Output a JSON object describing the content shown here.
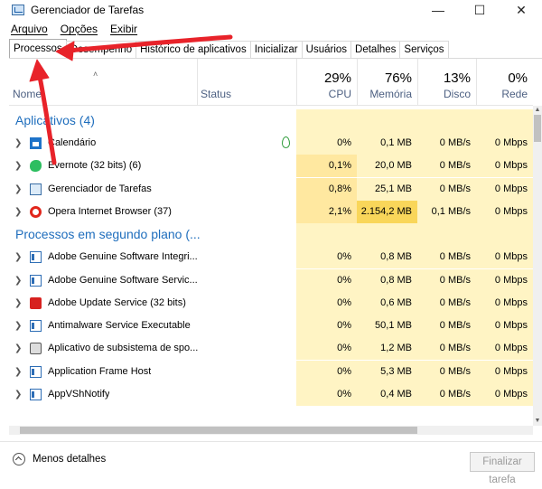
{
  "window": {
    "title": "Gerenciador de Tarefas",
    "controls": [
      "—",
      "☐",
      "✕"
    ]
  },
  "menu": [
    "Arquivo",
    "Opções",
    "Exibir"
  ],
  "tabs": [
    "Processos",
    "Desempenho",
    "Histórico de aplicativos",
    "Inicializar",
    "Usuários",
    "Detalhes",
    "Serviços"
  ],
  "active_tab": "Processos",
  "columns": {
    "name": "Nome",
    "status": "Status",
    "cpu": {
      "pct": "29%",
      "label": "CPU"
    },
    "memory": {
      "pct": "76%",
      "label": "Memória"
    },
    "disk": {
      "pct": "13%",
      "label": "Disco"
    },
    "network": {
      "pct": "0%",
      "label": "Rede"
    }
  },
  "groups": {
    "apps": "Aplicativos (4)",
    "background": "Processos em segundo plano (..."
  },
  "apps": [
    {
      "name": "Calendário",
      "icon": "calendar-icon",
      "status_icon": "leaf-icon",
      "cpu": "0%",
      "memory": "0,1 MB",
      "disk": "0 MB/s",
      "network": "0 Mbps"
    },
    {
      "name": "Evernote (32 bits) (6)",
      "icon": "evernote-icon",
      "cpu": "0,1%",
      "memory": "20,0 MB",
      "disk": "0 MB/s",
      "network": "0 Mbps"
    },
    {
      "name": "Gerenciador de Tarefas",
      "icon": "taskmanager-icon",
      "cpu": "0,8%",
      "memory": "25,1 MB",
      "disk": "0 MB/s",
      "network": "0 Mbps"
    },
    {
      "name": "Opera Internet Browser (37)",
      "icon": "opera-icon",
      "cpu": "2,1%",
      "memory": "2.154,2 MB",
      "disk": "0,1 MB/s",
      "network": "0 Mbps"
    }
  ],
  "background": [
    {
      "name": "Adobe Genuine Software Integri...",
      "icon": "service-icon",
      "cpu": "0%",
      "memory": "0,8 MB",
      "disk": "0 MB/s",
      "network": "0 Mbps"
    },
    {
      "name": "Adobe Genuine Software Servic...",
      "icon": "service-icon",
      "cpu": "0%",
      "memory": "0,8 MB",
      "disk": "0 MB/s",
      "network": "0 Mbps"
    },
    {
      "name": "Adobe Update Service (32 bits)",
      "icon": "adobe-icon",
      "cpu": "0%",
      "memory": "0,6 MB",
      "disk": "0 MB/s",
      "network": "0 Mbps"
    },
    {
      "name": "Antimalware Service Executable",
      "icon": "service-icon",
      "cpu": "0%",
      "memory": "50,1 MB",
      "disk": "0 MB/s",
      "network": "0 Mbps"
    },
    {
      "name": "Aplicativo de subsistema de spo...",
      "icon": "printer-icon",
      "cpu": "0%",
      "memory": "1,2 MB",
      "disk": "0 MB/s",
      "network": "0 Mbps"
    },
    {
      "name": "Application Frame Host",
      "icon": "service-icon",
      "cpu": "0%",
      "memory": "5,3 MB",
      "disk": "0 MB/s",
      "network": "0 Mbps"
    },
    {
      "name": "AppVShNotify",
      "icon": "service-icon",
      "cpu": "0%",
      "memory": "0,4 MB",
      "disk": "0 MB/s",
      "network": "0 Mbps"
    }
  ],
  "footer": {
    "less_details": "Menos detalhes",
    "end_task": "Finalizar tarefa"
  },
  "colors": {
    "heat_light": "#fff4c4",
    "heat_mid": "#ffe8a0",
    "heat_high": "#f9d65a",
    "group_text": "#1f6ebd",
    "annotation_arrow": "#e8232a"
  }
}
